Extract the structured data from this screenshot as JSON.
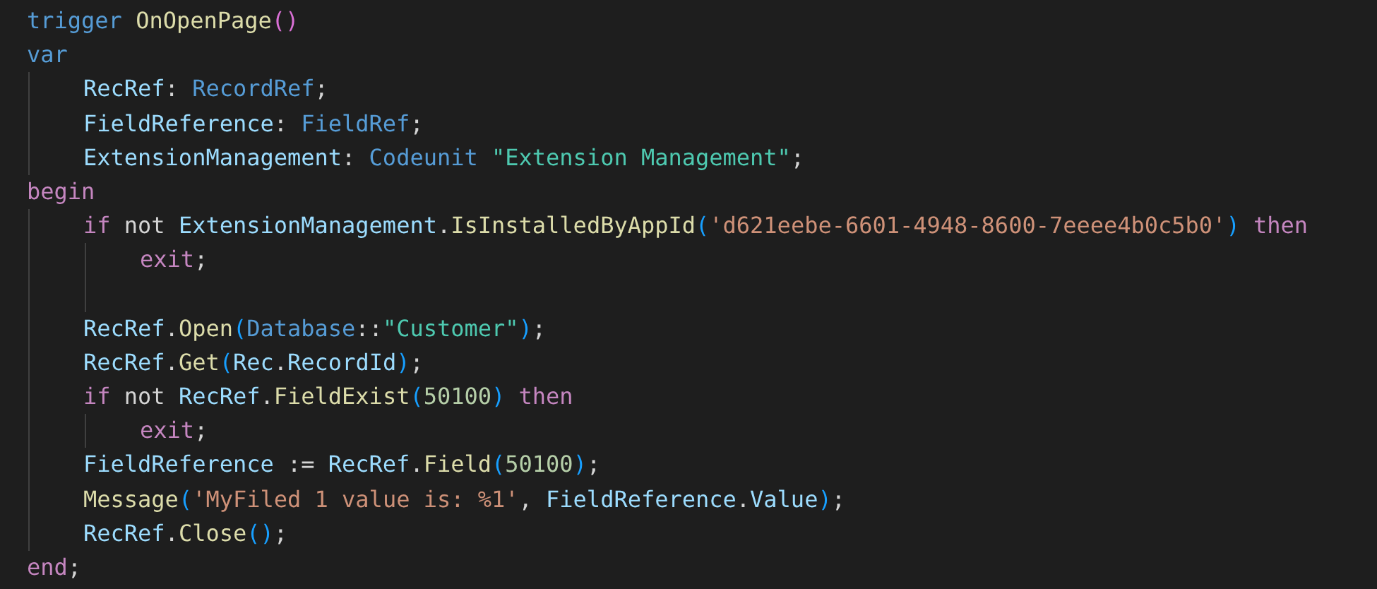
{
  "editor": {
    "lines": [
      {
        "tokens": [
          {
            "kind": "keyword",
            "text": "trigger "
          },
          {
            "kind": "function",
            "text": "OnOpenPage"
          },
          {
            "kind": "paren_outer",
            "text": "()"
          }
        ]
      },
      {
        "tokens": [
          {
            "kind": "keyword",
            "text": "var"
          }
        ],
        "children": [
          {
            "tokens": [
              {
                "kind": "variable",
                "text": "RecRef"
              },
              {
                "kind": "plain",
                "text": ": "
              },
              {
                "kind": "keyword",
                "text": "RecordRef"
              },
              {
                "kind": "plain",
                "text": ";"
              }
            ]
          },
          {
            "tokens": [
              {
                "kind": "variable",
                "text": "FieldReference"
              },
              {
                "kind": "plain",
                "text": ": "
              },
              {
                "kind": "keyword",
                "text": "FieldRef"
              },
              {
                "kind": "plain",
                "text": ";"
              }
            ]
          },
          {
            "tokens": [
              {
                "kind": "variable",
                "text": "ExtensionManagement"
              },
              {
                "kind": "plain",
                "text": ": "
              },
              {
                "kind": "keyword",
                "text": "Codeunit "
              },
              {
                "kind": "identifier",
                "text": "\"Extension Management\""
              },
              {
                "kind": "plain",
                "text": ";"
              }
            ]
          }
        ]
      },
      {
        "tokens": [
          {
            "kind": "control",
            "text": "begin"
          }
        ],
        "children": [
          {
            "tokens": [
              {
                "kind": "control",
                "text": "if"
              },
              {
                "kind": "plain",
                "text": " not "
              },
              {
                "kind": "variable",
                "text": "ExtensionManagement"
              },
              {
                "kind": "plain",
                "text": "."
              },
              {
                "kind": "function",
                "text": "IsInstalledByAppId"
              },
              {
                "kind": "paren",
                "text": "("
              },
              {
                "kind": "string",
                "text": "'d621eebe-6601-4948-8600-7eeee4b0c5b0'"
              },
              {
                "kind": "paren",
                "text": ") "
              },
              {
                "kind": "control",
                "text": "then"
              }
            ],
            "trailing_blank_line": true,
            "children": [
              {
                "tokens": [
                  {
                    "kind": "control",
                    "text": "exit"
                  },
                  {
                    "kind": "plain",
                    "text": ";"
                  }
                ]
              }
            ]
          },
          {
            "tokens": [
              {
                "kind": "variable",
                "text": "RecRef"
              },
              {
                "kind": "plain",
                "text": "."
              },
              {
                "kind": "function",
                "text": "Open"
              },
              {
                "kind": "paren",
                "text": "("
              },
              {
                "kind": "keyword",
                "text": "Database"
              },
              {
                "kind": "plain",
                "text": "::"
              },
              {
                "kind": "identifier",
                "text": "\"Customer\""
              },
              {
                "kind": "paren",
                "text": ")"
              },
              {
                "kind": "plain",
                "text": ";"
              }
            ]
          },
          {
            "tokens": [
              {
                "kind": "variable",
                "text": "RecRef"
              },
              {
                "kind": "plain",
                "text": "."
              },
              {
                "kind": "function",
                "text": "Get"
              },
              {
                "kind": "paren",
                "text": "("
              },
              {
                "kind": "variable",
                "text": "Rec"
              },
              {
                "kind": "plain",
                "text": "."
              },
              {
                "kind": "variable",
                "text": "RecordId"
              },
              {
                "kind": "paren",
                "text": ")"
              },
              {
                "kind": "plain",
                "text": ";"
              }
            ]
          },
          {
            "tokens": [
              {
                "kind": "control",
                "text": "if"
              },
              {
                "kind": "plain",
                "text": " not "
              },
              {
                "kind": "variable",
                "text": "RecRef"
              },
              {
                "kind": "plain",
                "text": "."
              },
              {
                "kind": "function",
                "text": "FieldExist"
              },
              {
                "kind": "paren",
                "text": "("
              },
              {
                "kind": "number",
                "text": "50100"
              },
              {
                "kind": "paren",
                "text": ") "
              },
              {
                "kind": "control",
                "text": "then"
              }
            ],
            "children": [
              {
                "tokens": [
                  {
                    "kind": "control",
                    "text": "exit"
                  },
                  {
                    "kind": "plain",
                    "text": ";"
                  }
                ]
              }
            ]
          },
          {
            "tokens": [
              {
                "kind": "variable",
                "text": "FieldReference"
              },
              {
                "kind": "plain",
                "text": " := "
              },
              {
                "kind": "variable",
                "text": "RecRef"
              },
              {
                "kind": "plain",
                "text": "."
              },
              {
                "kind": "function",
                "text": "Field"
              },
              {
                "kind": "paren",
                "text": "("
              },
              {
                "kind": "number",
                "text": "50100"
              },
              {
                "kind": "paren",
                "text": ")"
              },
              {
                "kind": "plain",
                "text": ";"
              }
            ]
          },
          {
            "tokens": [
              {
                "kind": "function",
                "text": "Message"
              },
              {
                "kind": "paren",
                "text": "("
              },
              {
                "kind": "string",
                "text": "'MyFiled 1 value is: %1'"
              },
              {
                "kind": "plain",
                "text": ", "
              },
              {
                "kind": "variable",
                "text": "FieldReference"
              },
              {
                "kind": "plain",
                "text": "."
              },
              {
                "kind": "variable",
                "text": "Value"
              },
              {
                "kind": "paren",
                "text": ")"
              },
              {
                "kind": "plain",
                "text": ";"
              }
            ]
          },
          {
            "tokens": [
              {
                "kind": "variable",
                "text": "RecRef"
              },
              {
                "kind": "plain",
                "text": "."
              },
              {
                "kind": "function",
                "text": "Close"
              },
              {
                "kind": "paren",
                "text": "()"
              },
              {
                "kind": "plain",
                "text": ";"
              }
            ]
          }
        ]
      },
      {
        "tokens": [
          {
            "kind": "control",
            "text": "end"
          },
          {
            "kind": "plain",
            "text": ";"
          }
        ]
      }
    ]
  }
}
